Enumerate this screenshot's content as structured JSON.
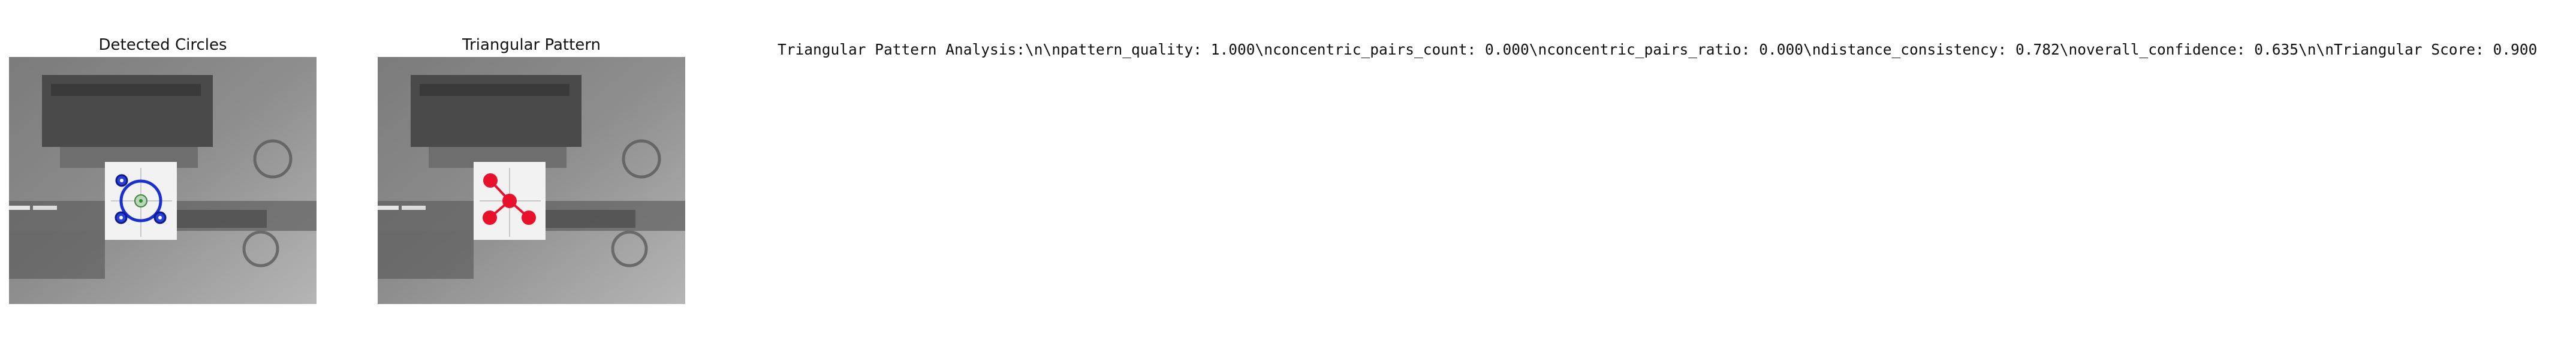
{
  "colors": {
    "circle_outline": "#1a2fd0",
    "pattern_marker": "#e8102a",
    "center_marker": "#2e8b2e",
    "background_gray": "#8a8a8a"
  },
  "panels": [
    {
      "id": "detected-circles",
      "title": "Detected Circles"
    },
    {
      "id": "triangular-pattern",
      "title": "Triangular Pattern"
    }
  ],
  "analysis": {
    "text": "Triangular Pattern Analysis:\\n\\npattern_quality: 1.000\\nconcentric_pairs_count: 0.000\\nconcentric_pairs_ratio: 0.000\\ndistance_consistency: 0.782\\noverall_confidence: 0.635\\n\\nTriangular Score: 0.900"
  }
}
